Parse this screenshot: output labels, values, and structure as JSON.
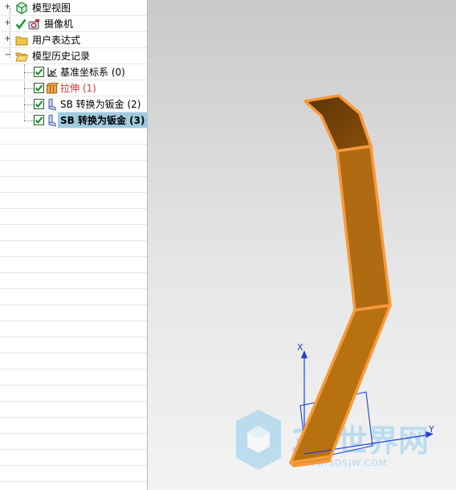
{
  "tree": {
    "items": [
      {
        "label": "模型视图",
        "icon": "model-view-icon"
      },
      {
        "label": "摄像机",
        "icon": "camera-icon"
      },
      {
        "label": "用户表达式",
        "icon": "folder-icon"
      },
      {
        "label": "模型历史记录",
        "icon": "folder-open-icon"
      },
      {
        "label": "基准坐标系 (0)",
        "icon": "datum-csys-icon"
      },
      {
        "label": "拉伸 (1)",
        "icon": "extrude-icon"
      },
      {
        "label": "SB 转换为钣金 (2)",
        "icon": "sheet-metal-icon"
      },
      {
        "label": "SB 转换为钣金 (3)",
        "icon": "sheet-metal-icon"
      }
    ]
  },
  "viewport": {
    "axis_x_label": "X",
    "axis_y_label": "Y",
    "watermark_text": "3D世界网",
    "watermark_url": "WWW.3DSJW.COM"
  },
  "colors": {
    "part_fill": "#b06a12",
    "part_edge": "#f79a3a",
    "selection_bg": "#9fcbe0",
    "error_text": "#e0322b",
    "axis_blue": "#1f3fd6"
  }
}
